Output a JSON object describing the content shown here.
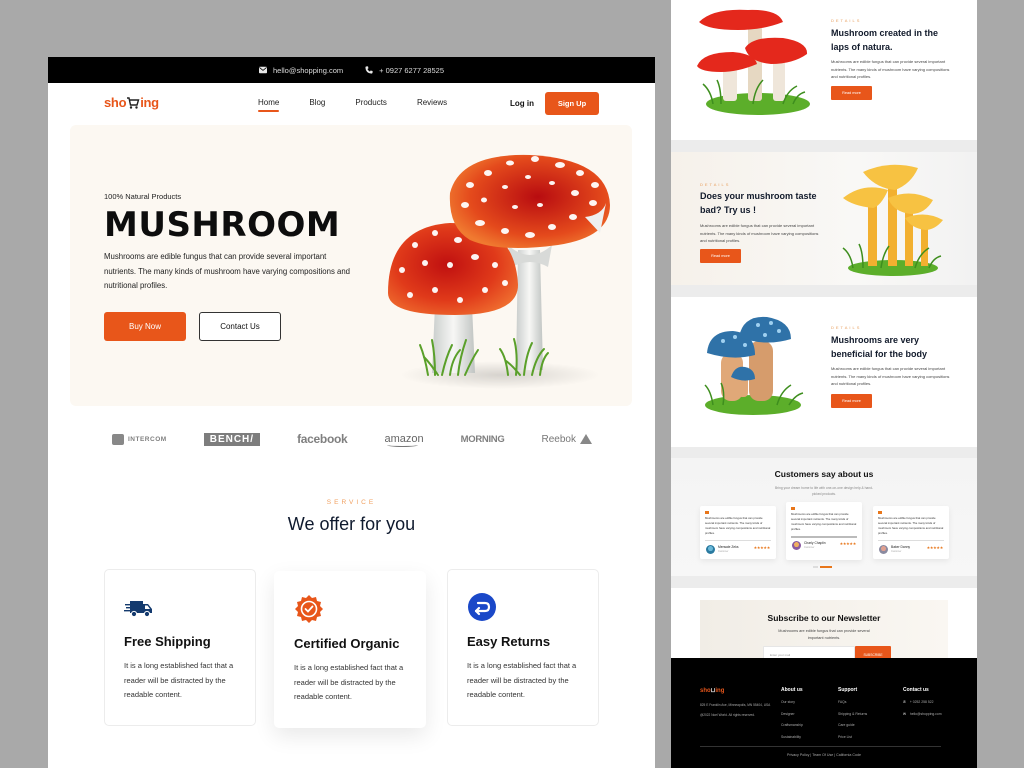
{
  "left_page": {
    "topbar": {
      "email": "hello@shopping.com",
      "phone": "+ 0927 6277 28525"
    },
    "nav": {
      "logo_text_a": "sho",
      "logo_text_b": "ing",
      "items": [
        {
          "label": "Home",
          "active": true
        },
        {
          "label": "Blog",
          "active": false
        },
        {
          "label": "Products",
          "active": false
        },
        {
          "label": "Reviews",
          "active": false
        }
      ],
      "login_label": "Log in",
      "signup_label": "Sign Up"
    },
    "hero": {
      "eyebrow": "100% Natural Products",
      "title": "MUSHROOM",
      "description": "Mushrooms are edible fungus that can provide several important nutrients. The many kinds of mushroom have varying compositions and nutritional profiles.",
      "buy_label": "Buy Now",
      "contact_label": "Contact Us"
    },
    "brands": [
      "INTERCOM",
      "BENCH/",
      "facebook",
      "amazon",
      "MORNING",
      "Reebok"
    ],
    "services": {
      "eyebrow": "SERVICE",
      "title": "We offer for you",
      "cards": [
        {
          "icon": "truck-icon",
          "title": "Free Shipping",
          "text": "It is a long established fact that a reader will be distracted by the readable content."
        },
        {
          "icon": "badge-check-icon",
          "title": "Certified Organic",
          "text": "It is a long established fact that a reader will be distracted by the readable content."
        },
        {
          "icon": "return-arrow-icon",
          "title": "Easy Returns",
          "text": "It is a long established fact that a reader will be distracted by the readable content."
        }
      ]
    }
  },
  "right_page": {
    "details": [
      {
        "eyebrow": "DETAILS",
        "title": "Mushroom created in the laps of natura.",
        "text": "Mushrooms are edible fungus that can provide several important nutrients. The many kinds of mushroom have varying compositions and nutritional profiles.",
        "button": "Read more"
      },
      {
        "eyebrow": "DETAILS",
        "title": "Does your mushroom taste bad? Try us !",
        "text": "Mushrooms are edible fungus that can provide several important nutrients. The many kinds of mushroom have varying compositions and nutritional profiles.",
        "button": "Read more"
      },
      {
        "eyebrow": "DETAILS",
        "title": "Mushrooms are very beneficial for the body",
        "text": "Mushrooms are edible fungus that can provide several important nutrients. The many kinds of mushroom have varying compositions and nutritional profiles.",
        "button": "Read more"
      }
    ],
    "testimonials": {
      "title": "Customers say about us",
      "subtitle": "Bring your dream home to life with one-on-one design help & hand-picked products.",
      "items": [
        {
          "text": "Mushrooms are edible fungus that can provide several important nutrients. The many kinds of mushroom have varying compositions and nutritional profiles.",
          "name": "Mensale Zeks",
          "role": "Customer",
          "stars": "★★★★★"
        },
        {
          "text": "Mushrooms are edible fungus that can provide several important nutrients. The many kinds of mushroom have varying compositions and nutritional profiles.",
          "name": "Charly Chaplin",
          "role": "Customer",
          "stars": "★★★★★"
        },
        {
          "text": "Mushrooms are edible fungus that can provide several important nutrients. The many kinds of mushroom have varying compositions and nutritional profiles.",
          "name": "Baker Danny",
          "role": "Customer",
          "stars": "★★★★★"
        }
      ]
    },
    "newsletter": {
      "title": "Subscribe to our Newsletter",
      "text": "Mushrooms are edible fungus that can provide several important nutrients.",
      "placeholder": "Enter your mail",
      "button": "SUBSCRIBE"
    },
    "footer": {
      "logo_text_a": "sho",
      "logo_text_b": "ing",
      "address": "825 E Franklin Ave, Minneapolis, MN 55404, USA",
      "copyright": "@2022 Noel World. All rights reserved.",
      "about": {
        "title": "About us",
        "links": [
          "Our story",
          "Designer",
          "Craftsmanship",
          "Sustainability"
        ]
      },
      "support": {
        "title": "Support",
        "links": [
          "FAQs",
          "Shipping & Returns",
          "Care guide",
          "Price List"
        ]
      },
      "contact": {
        "title": "Contact us",
        "phone": "+ 0252 258 522",
        "email": "hello@shopping.com"
      },
      "legal": "Privacy Policy  |  Team Of Use  |  California Code"
    }
  },
  "colors": {
    "accent": "#e8561a",
    "navy": "#0f1a2e",
    "hero_bg": "#fcf8f2",
    "return_blue": "#1a48c8"
  }
}
